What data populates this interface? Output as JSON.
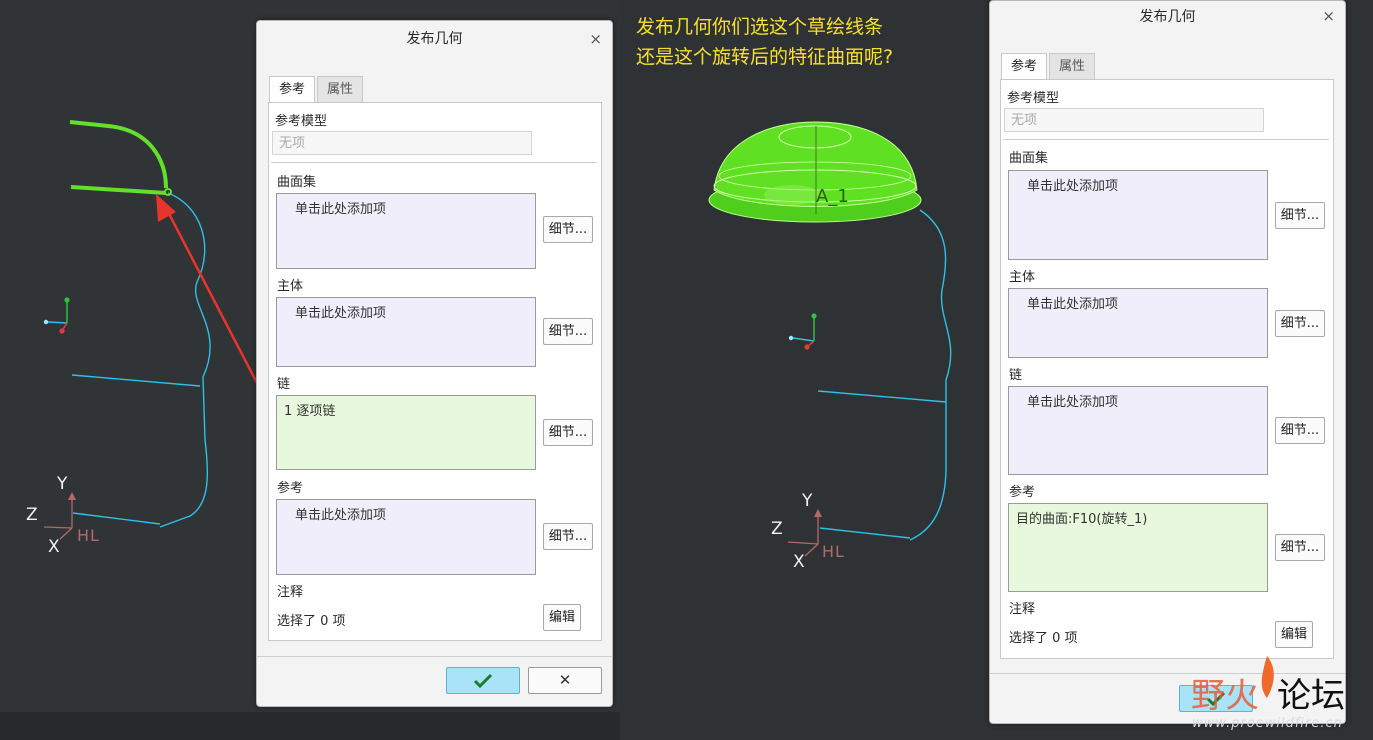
{
  "annotation": {
    "line1": "发布几何你们选这个草绘线条",
    "line2": "还是这个旋转后的特征曲面呢?"
  },
  "viewport_left": {
    "axes": {
      "y": "Y",
      "z": "Z",
      "x": "X",
      "hl": "HL"
    }
  },
  "viewport_right": {
    "feature_label": "A_1",
    "axes": {
      "y": "Y",
      "z": "Z",
      "x": "X",
      "hl": "HL"
    }
  },
  "dialog_left": {
    "title": "发布几何",
    "tabs": [
      "参考",
      "属性"
    ],
    "ref_model_label": "参考模型",
    "ref_model_placeholder": "无项",
    "surface_set_label": "曲面集",
    "surface_set_value": "单击此处添加项",
    "body_label": "主体",
    "body_value": "单击此处添加项",
    "chain_label": "链",
    "chain_value": "1 逐项链",
    "ref_label": "参考",
    "ref_value": "单击此处添加项",
    "details_button": "细节...",
    "note_label": "注释",
    "selected_text": "选择了 0 项",
    "edit_button": "编辑",
    "close_glyph": "×",
    "cancel_glyph": "✕"
  },
  "dialog_right": {
    "title": "发布几何",
    "tabs": [
      "参考",
      "属性"
    ],
    "ref_model_label": "参考模型",
    "ref_model_placeholder": "无项",
    "surface_set_label": "曲面集",
    "surface_set_value": "单击此处添加项",
    "body_label": "主体",
    "body_value": "单击此处添加项",
    "chain_label": "链",
    "chain_value": "单击此处添加项",
    "ref_label": "参考",
    "ref_value": "目的曲面:F10(旋转_1)",
    "details_button": "细节...",
    "note_label": "注释",
    "selected_text": "选择了 0 项",
    "edit_button": "编辑",
    "close_glyph": "×"
  },
  "watermark": {
    "text_a": "野火",
    "text_b": "论坛",
    "url": "www.proewildfire.cn"
  },
  "colors": {
    "curve_cyan": "#2ec0e6",
    "sketch_green": "#62e02a",
    "arrow_red": "#e8342c",
    "annotation_yellow": "#f7e02a",
    "ok_blue": "#a8e3f7"
  }
}
